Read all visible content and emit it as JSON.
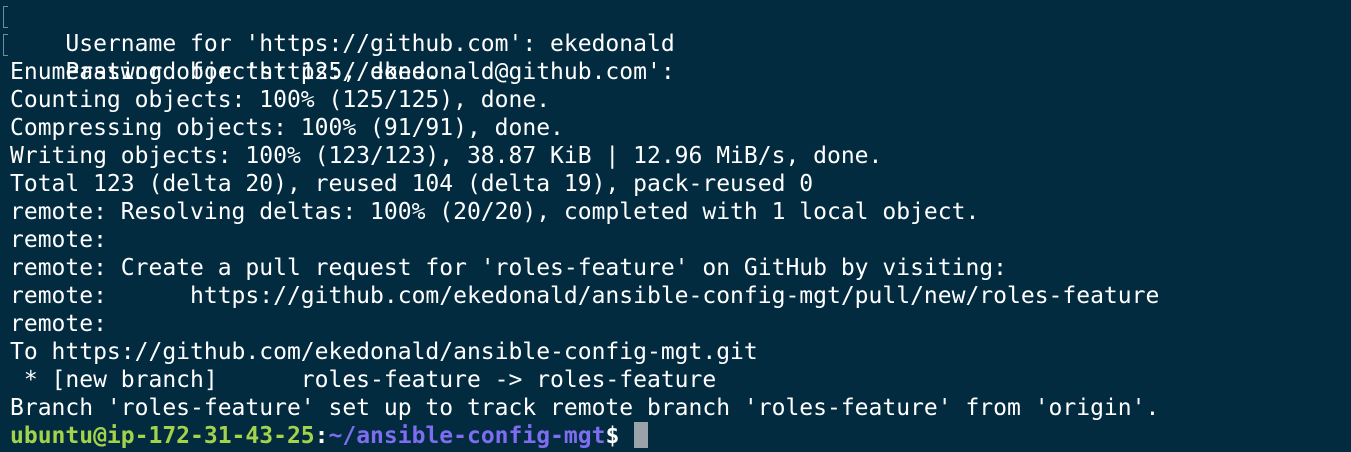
{
  "terminal": {
    "lines": [
      "Username for 'https://github.com': ekedonald",
      "Password for 'https://ekedonald@github.com':",
      "Enumerating objects: 125, done.",
      "Counting objects: 100% (125/125), done.",
      "Compressing objects: 100% (91/91), done.",
      "Writing objects: 100% (123/123), 38.87 KiB | 12.96 MiB/s, done.",
      "Total 123 (delta 20), reused 104 (delta 19), pack-reused 0",
      "remote: Resolving deltas: 100% (20/20), completed with 1 local object.",
      "remote:",
      "remote: Create a pull request for 'roles-feature' on GitHub by visiting:",
      "remote:      https://github.com/ekedonald/ansible-config-mgt/pull/new/roles-feature",
      "remote:",
      "To https://github.com/ekedonald/ansible-config-mgt.git",
      " * [new branch]      roles-feature -> roles-feature",
      "Branch 'roles-feature' set up to track remote branch 'roles-feature' from 'origin'."
    ],
    "prompt": {
      "user_host": "ubuntu@ip-172-31-43-25",
      "separator": ":",
      "path": "~/ansible-config-mgt",
      "symbol": "$"
    }
  },
  "colors": {
    "background": "#022b40",
    "text": "#ffffff",
    "prompt_user": "#a3d34a",
    "prompt_path": "#7e6df0",
    "cursor": "#9aa3aa"
  }
}
